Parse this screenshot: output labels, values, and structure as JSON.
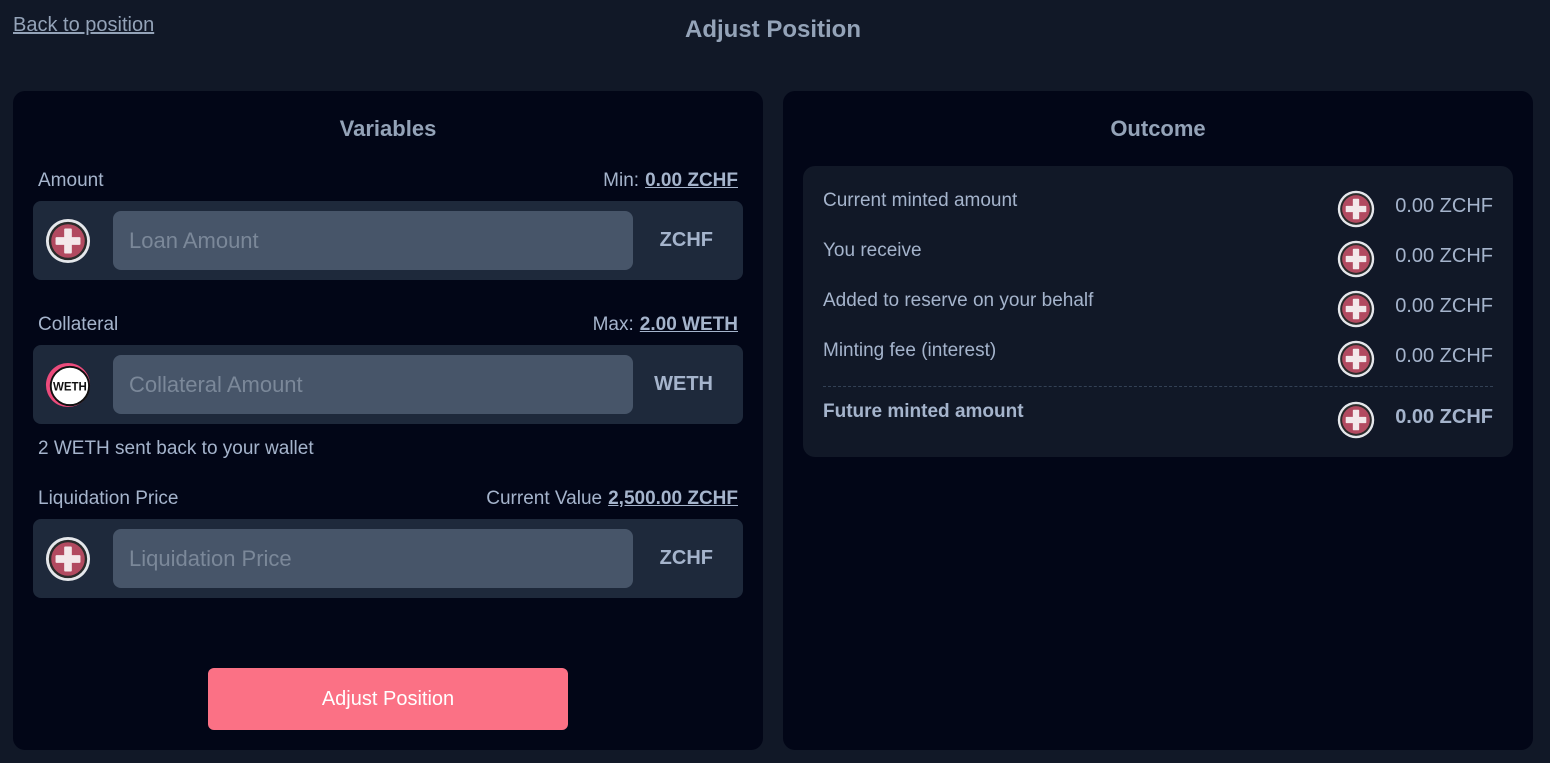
{
  "header": {
    "back_link": "Back to position",
    "title": "Adjust Position"
  },
  "variables": {
    "title": "Variables",
    "amount": {
      "label": "Amount",
      "meta_label": "Min:",
      "meta_value": "0.00 ZCHF",
      "placeholder": "Loan Amount",
      "unit": "ZCHF",
      "icon": "zchf-token-icon"
    },
    "collateral": {
      "label": "Collateral",
      "meta_label": "Max:",
      "meta_value": "2.00 WETH",
      "placeholder": "Collateral Amount",
      "unit": "WETH",
      "icon": "weth-token-icon",
      "icon_text": "WETH",
      "hint": "2 WETH sent back to your wallet"
    },
    "liquidation": {
      "label": "Liquidation Price",
      "meta_label": "Current Value",
      "meta_value": "2,500.00 ZCHF",
      "placeholder": "Liquidation Price",
      "unit": "ZCHF",
      "icon": "zchf-token-icon"
    },
    "submit_label": "Adjust Position"
  },
  "outcome": {
    "title": "Outcome",
    "rows": [
      {
        "label": "Current minted amount",
        "value": "0.00 ZCHF"
      },
      {
        "label": "You receive",
        "value": "0.00 ZCHF"
      },
      {
        "label": "Added to reserve on your behalf",
        "value": "0.00 ZCHF"
      },
      {
        "label": "Minting fee (interest)",
        "value": "0.00 ZCHF"
      }
    ],
    "total": {
      "label": "Future minted amount",
      "value": "0.00 ZCHF"
    }
  },
  "colors": {
    "background": "#111827",
    "panel": "#020617",
    "accent_button": "#fb7185",
    "zchf_token": "#c2415b"
  }
}
